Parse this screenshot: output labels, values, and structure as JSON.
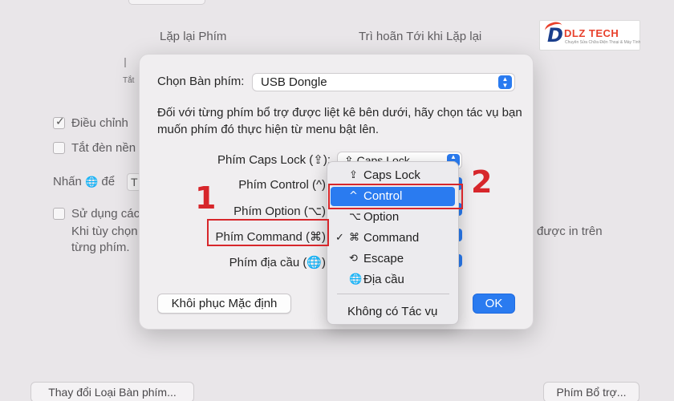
{
  "background": {
    "label_repeat": "Lặp lại Phím",
    "label_delay": "Trì hoãn Tới khi Lặp lại",
    "slider_left_label": "Tắt",
    "check_adjust": "Điều chỉnh",
    "check_light": "Tắt đèn nền",
    "press_label": "Nhấn",
    "press_suffix": "để",
    "mini_select_text": "T",
    "check_use": "Sử dụng các",
    "customize_line": "Khi tùy chọn",
    "customize_line_end": "được in trên",
    "per_key_line": "từng phím.",
    "change_keyboard_type_button": "Thay đổi Loại Bàn phím...",
    "modifier_keys_button": "Phím Bổ trợ..."
  },
  "logo": {
    "mark": "D",
    "name": "DLZ TECH",
    "tagline": "Chuyên Sửa Chữa Điện Thoại & Máy Tính"
  },
  "dialog": {
    "keyboard_label": "Chọn Bàn phím:",
    "keyboard_value": "USB Dongle",
    "description": "Đối với từng phím bổ trợ được liệt kê bên dưới, hãy chọn tác vụ bạn muốn phím đó thực hiện từ menu bật lên.",
    "rows": [
      {
        "label": "Phím Caps Lock (⇪):",
        "value": "⇪ Caps Lock"
      },
      {
        "label": "Phím Control (^)",
        "value": ""
      },
      {
        "label": "Phím Option (⌥)",
        "value": ""
      },
      {
        "label": "Phím Command (⌘)",
        "value": ""
      },
      {
        "label": "Phím địa cầu (🌐)",
        "value": ""
      }
    ],
    "reset_button": "Khôi phục Mặc định",
    "ok_button": "OK"
  },
  "menu": {
    "items": [
      {
        "glyph": "⇪",
        "label": "Caps Lock",
        "checked": ""
      },
      {
        "glyph": "^",
        "label": "Control",
        "checked": ""
      },
      {
        "glyph": "⌥",
        "label": "Option",
        "checked": ""
      },
      {
        "glyph": "⌘",
        "label": "Command",
        "checked": "✓"
      },
      {
        "glyph": "⟲",
        "label": "Escape",
        "checked": ""
      },
      {
        "glyph": "🌐",
        "label": "Địa cầu",
        "checked": ""
      }
    ],
    "no_action": "Không có Tác vụ"
  },
  "annotations": {
    "step1": "1",
    "step2": "2",
    "color": "#d7262b"
  },
  "colors": {
    "accent": "#2a7bf0"
  }
}
